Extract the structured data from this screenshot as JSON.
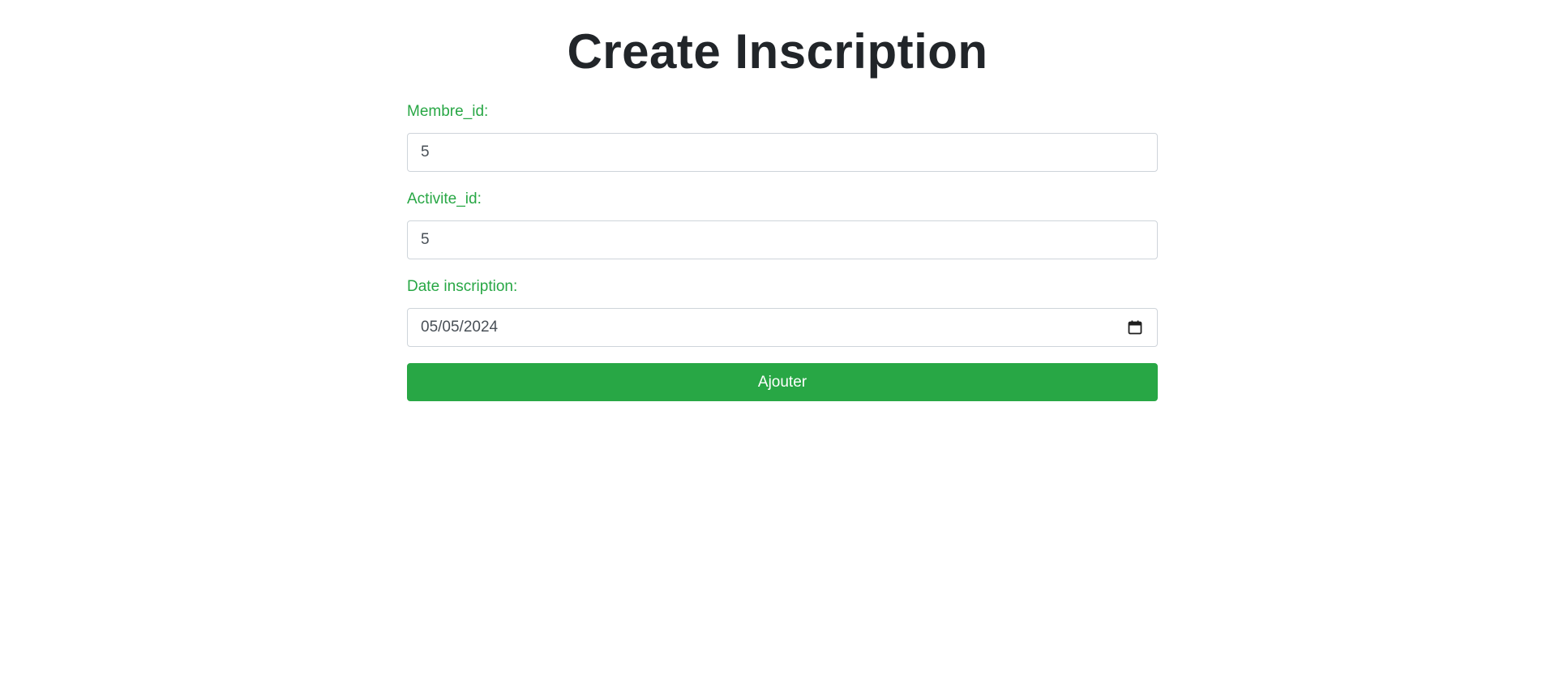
{
  "page": {
    "title": "Create Inscription"
  },
  "form": {
    "membre_id": {
      "label": "Membre_id:",
      "value": "5"
    },
    "activite_id": {
      "label": "Activite_id:",
      "value": "5"
    },
    "date_inscription": {
      "label": "Date inscription:",
      "value": "05/05/2024",
      "icon": "calendar-icon"
    },
    "submit_label": "Ajouter"
  },
  "colors": {
    "accent": "#28a745",
    "title": "#212529",
    "input_border": "#ced4da",
    "input_text": "#495057"
  }
}
